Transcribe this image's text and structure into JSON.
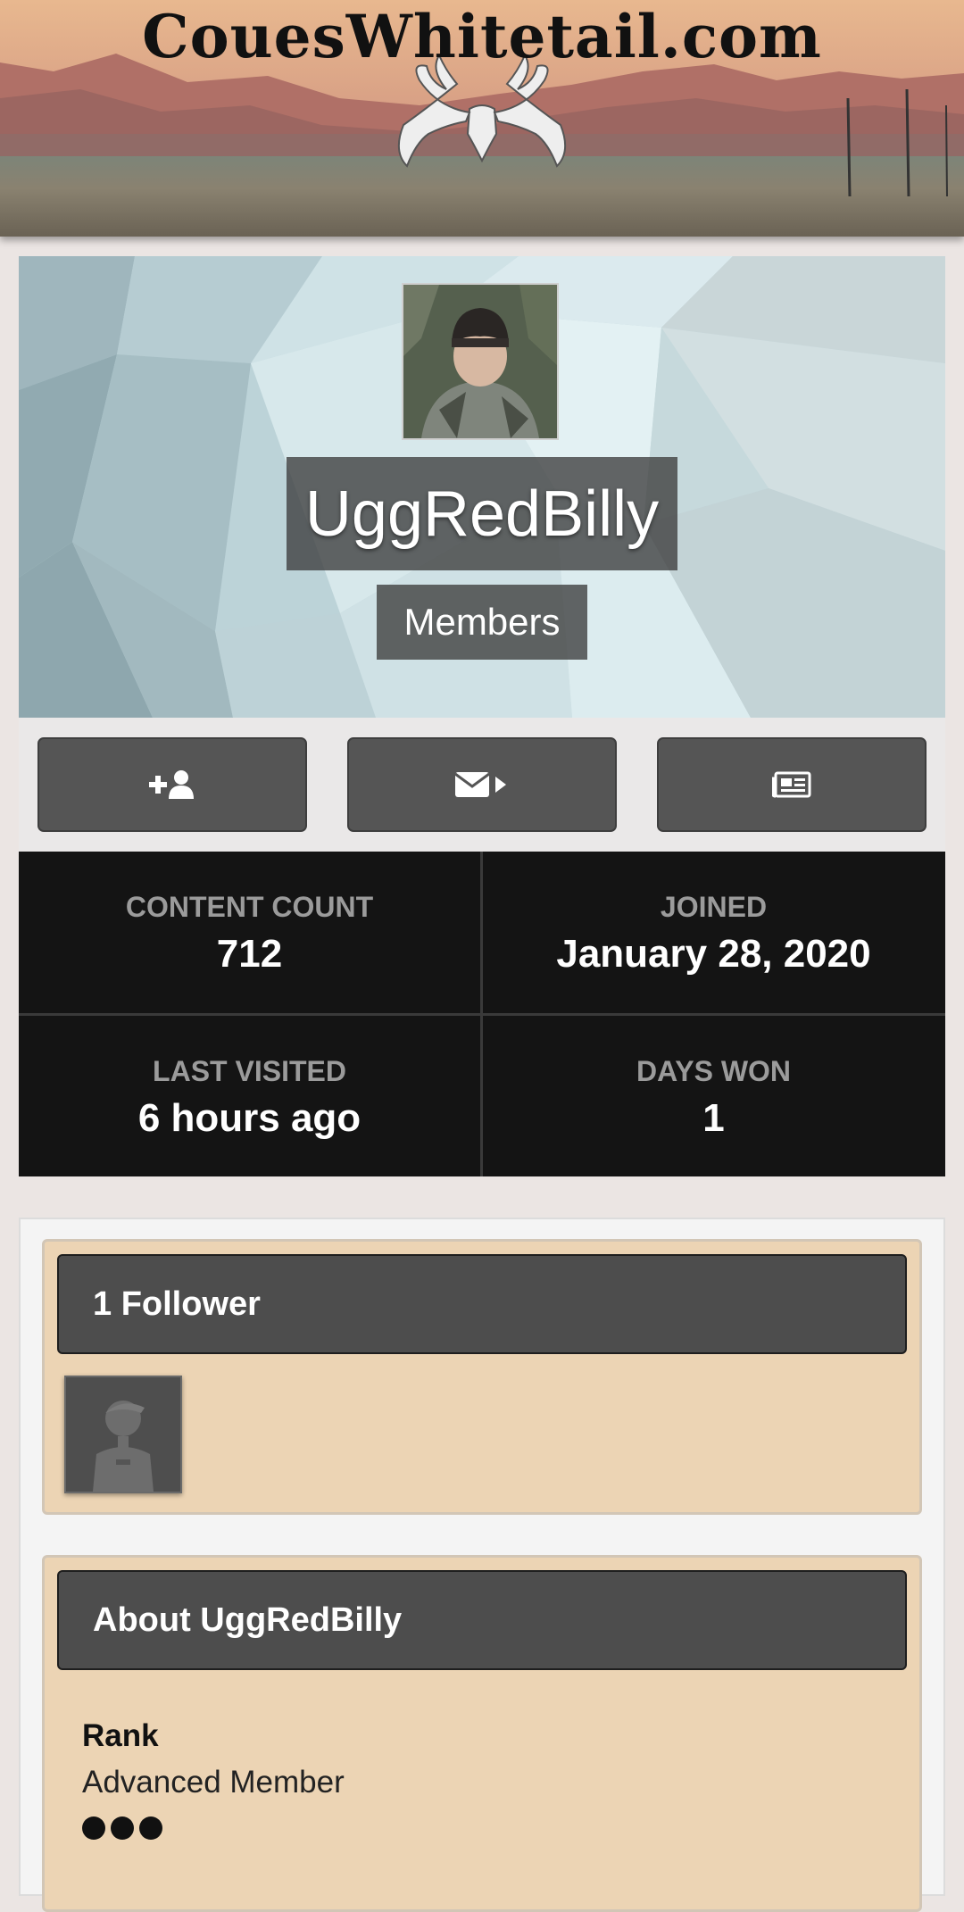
{
  "header": {
    "site_title": "CouesWhitetail.com",
    "logo_icon": "antler-skull-icon"
  },
  "profile": {
    "username": "UggRedBilly",
    "group": "Members",
    "avatar_icon": "profile-photo"
  },
  "actions": [
    {
      "name": "follow-button",
      "icon": "user-plus-icon"
    },
    {
      "name": "message-button",
      "icon": "envelope-icon"
    },
    {
      "name": "activity-button",
      "icon": "newspaper-icon"
    }
  ],
  "stats": {
    "content_count": {
      "label": "CONTENT COUNT",
      "value": "712"
    },
    "joined": {
      "label": "JOINED",
      "value": "January 28, 2020"
    },
    "last_visited": {
      "label": "LAST VISITED",
      "value": "6 hours ago"
    },
    "days_won": {
      "label": "DAYS WON",
      "value": "1"
    }
  },
  "followers": {
    "title": "1 Follower",
    "items": [
      {
        "icon": "default-avatar-icon"
      }
    ]
  },
  "about": {
    "title": "About UggRedBilly",
    "rank_label": "Rank",
    "rank_value": "Advanced Member",
    "rank_pips": 3
  },
  "colors": {
    "widget_bg": "#ecd4b4",
    "header_dark": "#4d4d4d",
    "stats_bg": "#141414",
    "button_bg": "#555555"
  }
}
